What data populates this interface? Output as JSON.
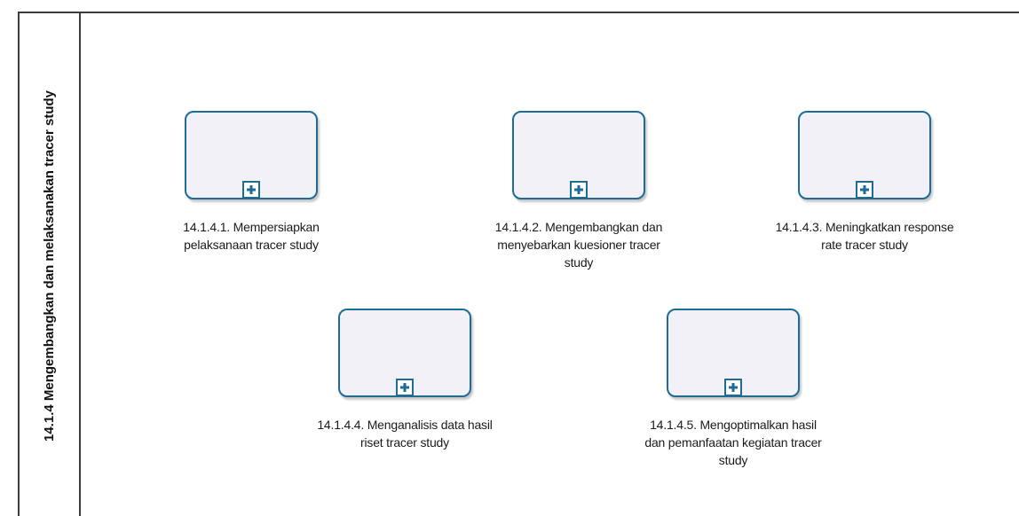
{
  "lane": {
    "title": "14.1.4 Mengembangkan dan melaksanakan tracer study"
  },
  "tasks": [
    {
      "id": "task-1",
      "label_lines": [
        "14.1.4.1. Mempersiapkan",
        "pelaksanaan tracer study"
      ],
      "marker": "plus-icon"
    },
    {
      "id": "task-2",
      "label_lines": [
        "14.1.4.2. Mengembangkan dan",
        "menyebarkan kuesioner tracer",
        "study"
      ],
      "marker": "plus-icon"
    },
    {
      "id": "task-3",
      "label_lines": [
        "14.1.4.3. Meningkatkan response",
        "rate tracer study"
      ],
      "marker": "plus-icon"
    },
    {
      "id": "task-4",
      "label_lines": [
        "14.1.4.4. Menganalisis data hasil",
        "riset tracer study"
      ],
      "marker": "plus-icon"
    },
    {
      "id": "task-5",
      "label_lines": [
        "14.1.4.5. Mengoptimalkan hasil",
        "dan pemanfaatan kegiatan tracer",
        "study"
      ],
      "marker": "plus-icon"
    }
  ],
  "colors": {
    "task_border": "#1d6c96",
    "task_fill": "#f1f1f7",
    "lane_border": "#3c3c3c"
  }
}
